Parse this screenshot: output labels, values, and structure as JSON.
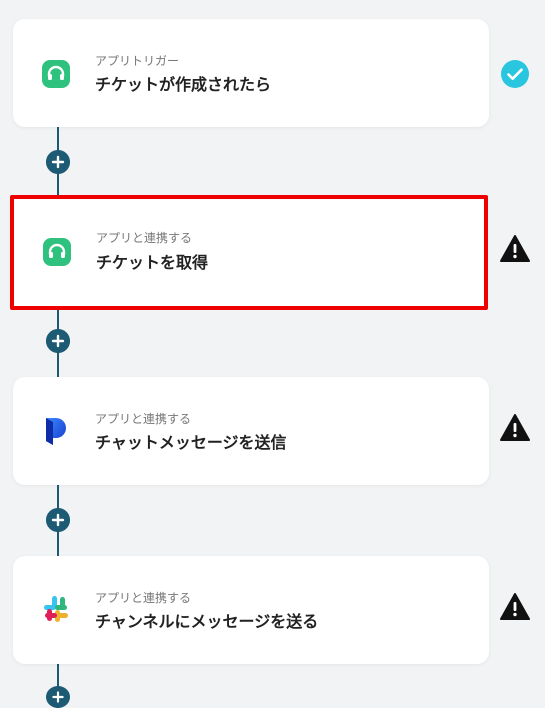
{
  "colors": {
    "connector": "#1d5a73",
    "success": "#2ac6e0",
    "warning": "#111111",
    "selected_border": "#ee0000",
    "headset_app": "#2ec27e"
  },
  "steps": [
    {
      "subtitle": "アプリトリガー",
      "title": "チケットが作成されたら",
      "icon": "headset-app-icon",
      "status": "check-icon"
    },
    {
      "subtitle": "アプリと連携する",
      "title": "チケットを取得",
      "icon": "headset-app-icon",
      "status": "warning-icon",
      "selected": true
    },
    {
      "subtitle": "アプリと連携する",
      "title": "チャットメッセージを送信",
      "icon": "p-app-icon",
      "status": "warning-icon"
    },
    {
      "subtitle": "アプリと連携する",
      "title": "チャンネルにメッセージを送る",
      "icon": "slack-icon",
      "status": "warning-icon"
    }
  ]
}
